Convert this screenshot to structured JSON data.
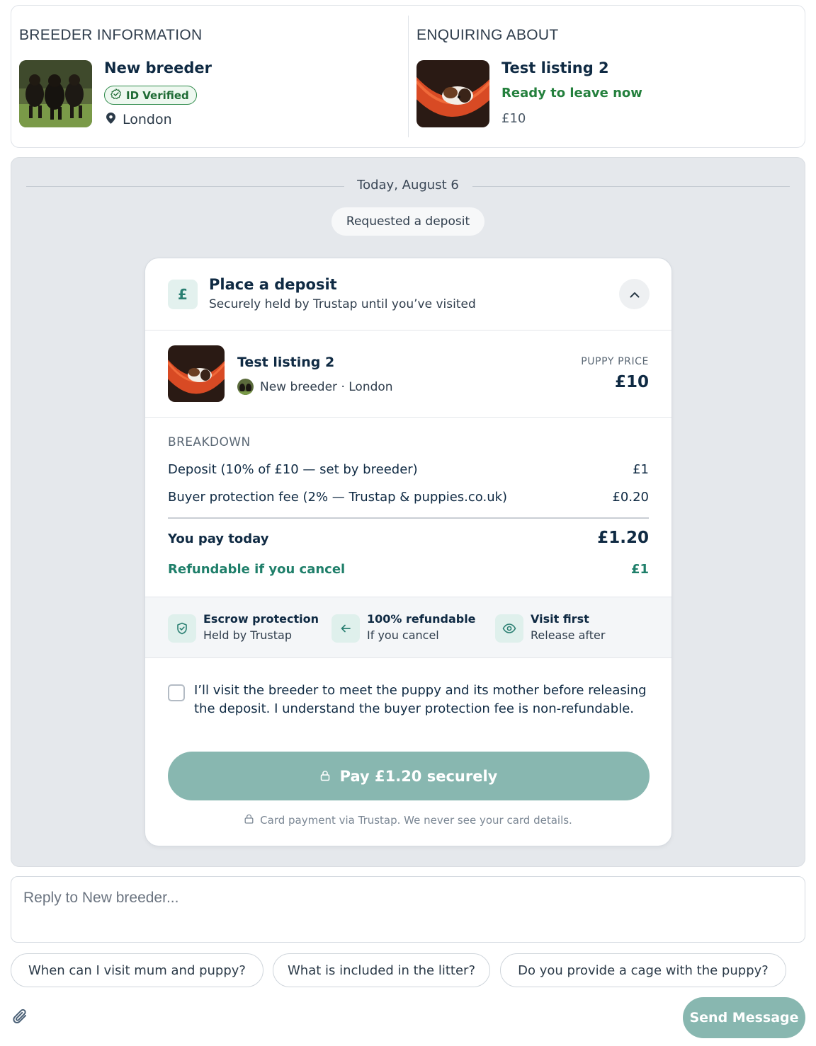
{
  "breeder_info": {
    "heading": "BREEDER INFORMATION",
    "name": "New breeder",
    "badge": "ID Verified",
    "location": "London"
  },
  "enquiring": {
    "heading": "ENQUIRING ABOUT",
    "title": "Test listing 2",
    "status": "Ready to leave now",
    "price": "£10"
  },
  "chat": {
    "date": "Today, August 6",
    "event": "Requested a deposit"
  },
  "deposit": {
    "icon_symbol": "£",
    "title": "Place a deposit",
    "subtitle": "Securely held by Trustap until you’ve visited",
    "listing_title": "Test listing 2",
    "listing_meta": "New breeder · London",
    "price_label": "PUPPY PRICE",
    "price_value": "£10",
    "breakdown_label": "BREAKDOWN",
    "rows": [
      {
        "label": "Deposit (10% of £10 — set by breeder)",
        "value": "£1"
      },
      {
        "label": "Buyer protection fee (2% — Trustap & puppies.co.uk)",
        "value": "£0.20"
      }
    ],
    "total_label": "You pay today",
    "total_value": "£1.20",
    "refund_label": "Refundable if you cancel",
    "refund_value": "£1",
    "features": [
      {
        "title": "Escrow protection",
        "sub": "Held by Trustap",
        "icon": "shield-check-icon"
      },
      {
        "title": "100% refundable",
        "sub": "If you cancel",
        "icon": "arrow-left-icon"
      },
      {
        "title": "Visit first",
        "sub": "Release after",
        "icon": "eye-icon"
      }
    ],
    "confirm_text": "I’ll visit the breeder to meet the puppy and its mother before releasing the deposit. I understand the buyer protection fee is non-refundable.",
    "pay_label": "Pay £1.20 securely",
    "pay_note": "Card payment via Trustap. We never see your card details."
  },
  "reply": {
    "placeholder": "Reply to New breeder..."
  },
  "suggestions": [
    "When can I visit mum and puppy?",
    "What is included in the litter?",
    "Do you provide a cage with the puppy?"
  ],
  "send_label": "Send Message",
  "colors": {
    "accent": "#88b7b0",
    "navy": "#0f2a43",
    "green": "#24803d",
    "teal": "#1f7f6a"
  }
}
